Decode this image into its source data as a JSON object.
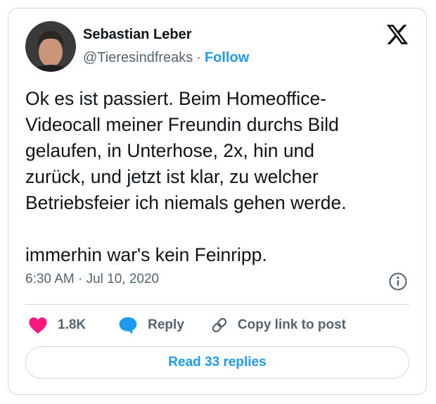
{
  "author": {
    "name": "Sebastian Leber",
    "handle": "@Tieresindfreaks",
    "separator": "·",
    "follow_label": "Follow"
  },
  "tweet": {
    "text": "Ok es ist passiert. Beim Homeoffice-\nVideocall meiner Freundin durchs Bild\ngelaufen, in Unterhose, 2x, hin und\nzurück, und jetzt ist klar, zu welcher\nBetriebsfeier ich niemals gehen werde.\n\nimmerhin war's kein Feinripp.",
    "timestamp": "6:30 AM · Jul 10, 2020"
  },
  "actions": {
    "like_count": "1.8K",
    "reply_label": "Reply",
    "copy_label": "Copy link to post"
  },
  "read_replies_label": "Read 33 replies",
  "icons": {
    "brand": "x-logo-icon",
    "info": "info-icon",
    "like": "heart-icon",
    "reply": "speech-bubble-icon",
    "copy": "link-icon"
  },
  "colors": {
    "accent": "#1d9bf0",
    "like": "#f91880",
    "text": "#0f1419",
    "muted": "#536471",
    "border": "#cfd9de"
  }
}
